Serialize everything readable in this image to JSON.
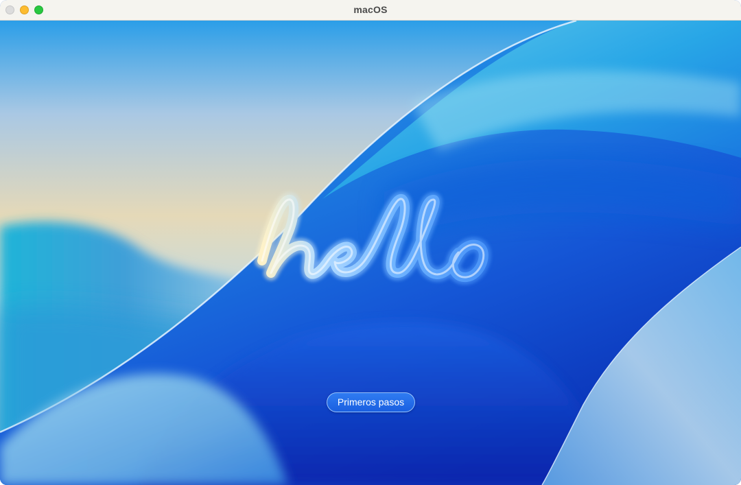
{
  "window": {
    "title": "macOS",
    "controls": [
      "close",
      "minimize",
      "zoom"
    ]
  },
  "welcome": {
    "greeting_icon": "hello-lettering-icon",
    "button_label": "Primeros pasos"
  },
  "colors": {
    "accent": "#1a5fe0",
    "titlebar": "#f5f4ef",
    "close": "#dcdcdc",
    "minimize": "#fdbc2e",
    "zoom": "#28c840"
  }
}
